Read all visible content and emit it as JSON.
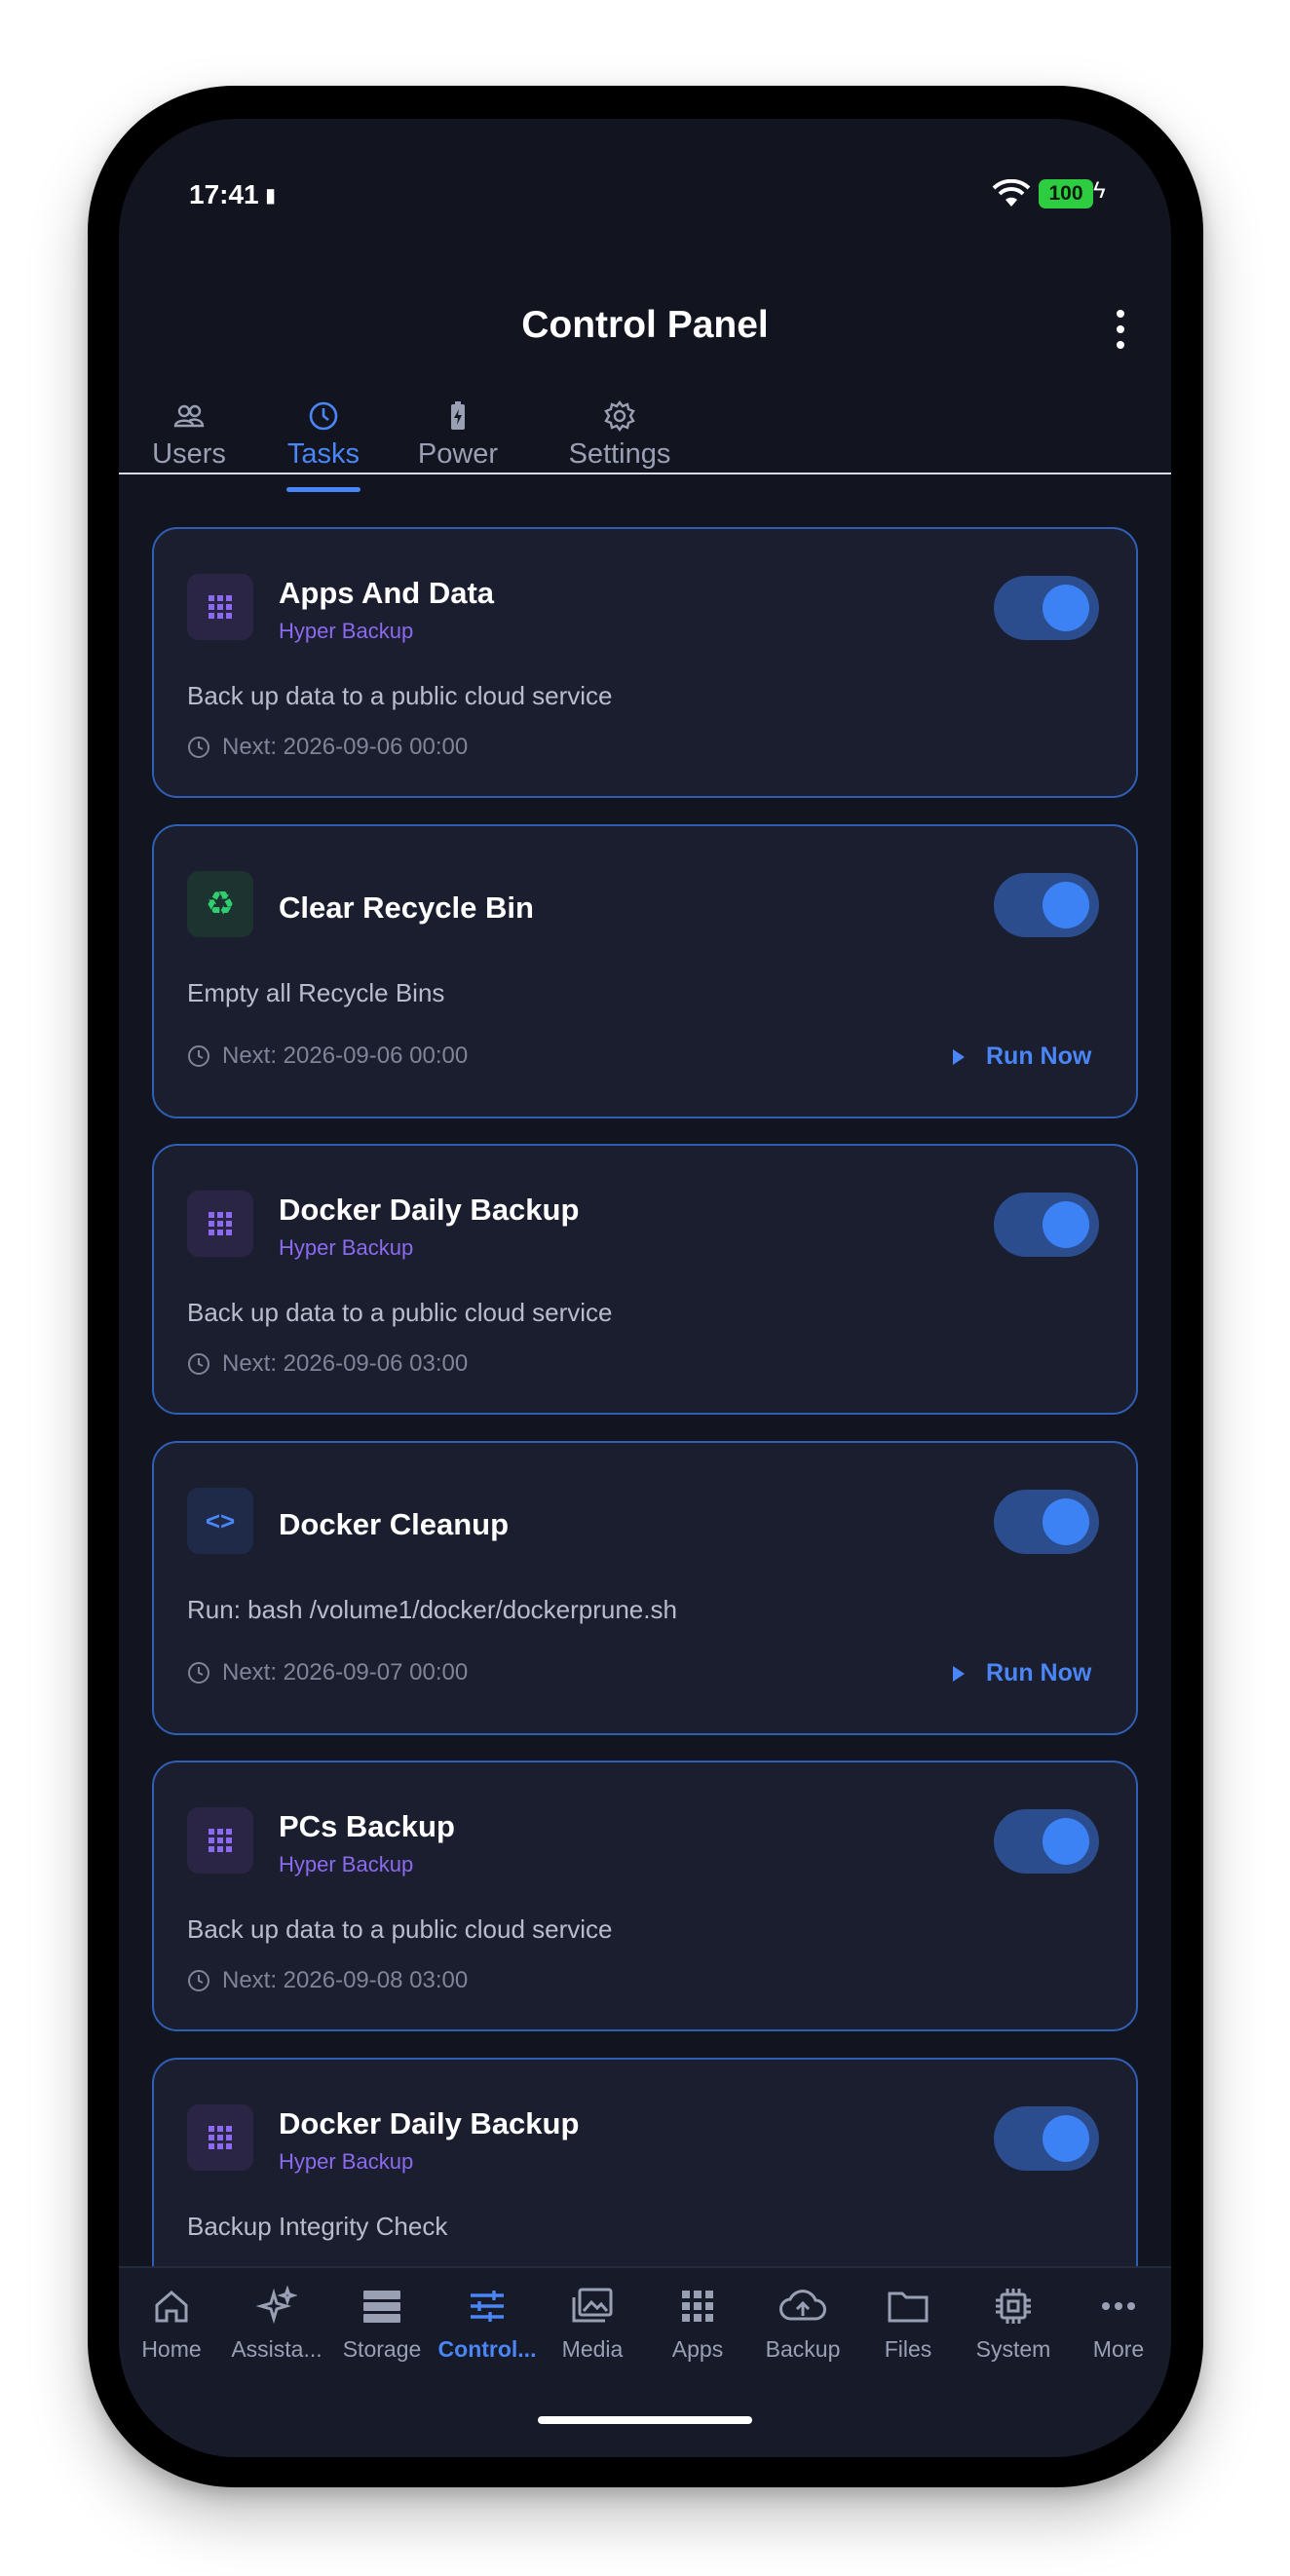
{
  "status_bar": {
    "time": "17:41",
    "battery": "100"
  },
  "header": {
    "title": "Control Panel"
  },
  "tabs": [
    {
      "label": "Users",
      "icon": "users-icon"
    },
    {
      "label": "Tasks",
      "icon": "clock-icon",
      "active": true
    },
    {
      "label": "Power",
      "icon": "battery-icon"
    },
    {
      "label": "Settings",
      "icon": "gear-icon"
    }
  ],
  "cards": [
    {
      "title": "Apps And Data",
      "subtitle": "Hyper Backup",
      "description": "Back up data to a public cloud service",
      "next": "Next: 2026-09-06 00:00",
      "enabled": true
    },
    {
      "title": "Clear Recycle Bin",
      "subtitle": "",
      "description": "Empty all Recycle Bins",
      "next": "Next: 2026-09-06 00:00",
      "run_now": "Run Now",
      "enabled": true
    },
    {
      "title": "Docker Daily Backup",
      "subtitle": "Hyper Backup",
      "description": "Back up data to a public cloud service",
      "next": "Next: 2026-09-06 03:00",
      "enabled": true
    },
    {
      "title": "Docker Cleanup",
      "subtitle": "",
      "description": "Run: bash /volume1/docker/dockerprune.sh",
      "next": "Next: 2026-09-07 00:00",
      "run_now": "Run Now",
      "enabled": true
    },
    {
      "title": "PCs Backup",
      "subtitle": "Hyper Backup",
      "description": "Back up data to a public cloud service",
      "next": "Next: 2026-09-08 03:00",
      "enabled": true
    },
    {
      "title": "Docker Daily Backup",
      "subtitle": "Hyper Backup",
      "description": "Backup Integrity Check",
      "next": "",
      "enabled": true
    }
  ],
  "bottom_nav": [
    {
      "label": "Home",
      "icon": "home-icon"
    },
    {
      "label": "Assista...",
      "icon": "sparkle-icon"
    },
    {
      "label": "Storage",
      "icon": "storage-icon"
    },
    {
      "label": "Control...",
      "icon": "sliders-icon",
      "active": true
    },
    {
      "label": "Media",
      "icon": "media-icon"
    },
    {
      "label": "Apps",
      "icon": "apps-icon"
    },
    {
      "label": "Backup",
      "icon": "cloud-upload-icon"
    },
    {
      "label": "Files",
      "icon": "folder-icon"
    },
    {
      "label": "System",
      "icon": "chip-icon"
    },
    {
      "label": "More",
      "icon": "more-icon"
    }
  ],
  "colors": {
    "accent": "#4a86f7",
    "background": "#12141f",
    "card": "#1b1e2e",
    "card_border": "#2f5fb5",
    "subtitle": "#8b6af0",
    "toggle_on": "#3d82f5"
  }
}
